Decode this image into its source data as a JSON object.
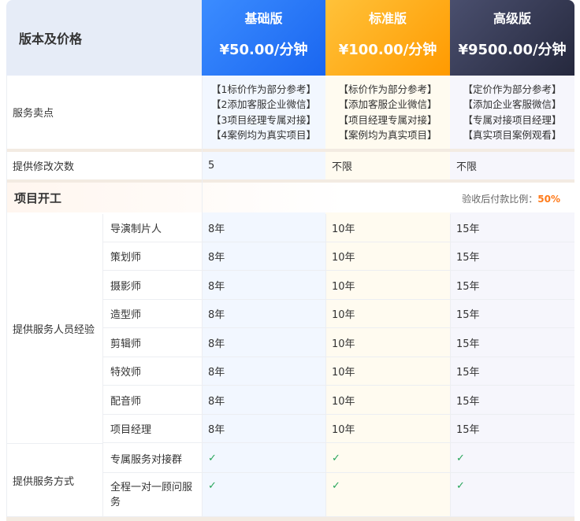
{
  "header": {
    "label": "版本及价格",
    "plans": [
      {
        "name": "基础版",
        "price": "¥50.00/分钟"
      },
      {
        "name": "标准版",
        "price": "¥100.00/分钟"
      },
      {
        "name": "高级版",
        "price": "¥9500.00/分钟"
      }
    ]
  },
  "selling_points": {
    "label": "服务卖点",
    "basic": [
      "【1标价作为部分参考】",
      "【2添加客服企业微信】",
      "【3项目经理专属对接】",
      "【4案例均为真实项目】"
    ],
    "standard": [
      "【标价作为部分参考】",
      "【添加客服企业微信】",
      "【项目经理专属对接】",
      "【案例均为真实项目】"
    ],
    "advanced": [
      "【定价作为部分参考】",
      "【添加企业客服微信】",
      "【专属对接项目经理】",
      "【真实项目案例观看】"
    ]
  },
  "revisions": {
    "label": "提供修改次数",
    "basic": "5",
    "standard": "不限",
    "advanced": "不限"
  },
  "section": {
    "title": "项目开工",
    "note_label": "验收后付款比例：",
    "note_value": "50%"
  },
  "experience": {
    "label": "提供服务人员经验",
    "rows": [
      {
        "role": "导演制片人",
        "basic": "8年",
        "standard": "10年",
        "advanced": "15年"
      },
      {
        "role": "策划师",
        "basic": "8年",
        "standard": "10年",
        "advanced": "15年"
      },
      {
        "role": "摄影师",
        "basic": "8年",
        "standard": "10年",
        "advanced": "15年"
      },
      {
        "role": "造型师",
        "basic": "8年",
        "standard": "10年",
        "advanced": "15年"
      },
      {
        "role": "剪辑师",
        "basic": "8年",
        "standard": "10年",
        "advanced": "15年"
      },
      {
        "role": "特效师",
        "basic": "8年",
        "standard": "10年",
        "advanced": "15年"
      },
      {
        "role": "配音师",
        "basic": "8年",
        "standard": "10年",
        "advanced": "15年"
      },
      {
        "role": "项目经理",
        "basic": "8年",
        "standard": "10年",
        "advanced": "15年"
      }
    ]
  },
  "service_mode": {
    "label": "提供服务方式",
    "rows": [
      {
        "name": "专属服务对接群",
        "basic": "✓",
        "standard": "✓",
        "advanced": "✓"
      },
      {
        "name": "全程一对一顾问服务",
        "basic": "✓",
        "standard": "✓",
        "advanced": "✓"
      }
    ]
  },
  "colors": {
    "basic": "#1a66f0",
    "standard": "#ff9a00",
    "advanced": "#25283d",
    "check": "#27a55a",
    "accent": "#ff7a1a"
  }
}
